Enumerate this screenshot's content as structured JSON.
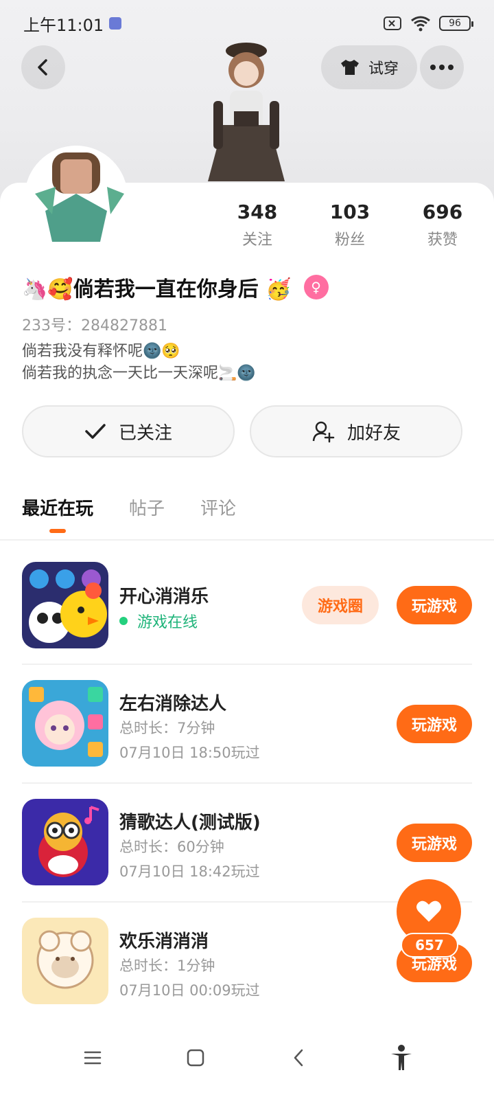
{
  "status_bar": {
    "time": "上午11:01",
    "battery": "96"
  },
  "header": {
    "try_on_label": "试穿"
  },
  "profile": {
    "stats": [
      {
        "value": "348",
        "label": "关注"
      },
      {
        "value": "103",
        "label": "粉丝"
      },
      {
        "value": "696",
        "label": "获赞"
      }
    ],
    "name": "🦄🥰倘若我一直在你身后 🥳",
    "id_label": "233号：284827881",
    "bio_lines": [
      "倘若我没有释怀呢🌚🥺",
      "倘若我的执念一天比一天深呢🚬🌚"
    ]
  },
  "actions": {
    "follow_label": "已关注",
    "add_friend_label": "加好友"
  },
  "tabs": [
    {
      "label": "最近在玩",
      "active": true
    },
    {
      "label": "帖子",
      "active": false
    },
    {
      "label": "评论",
      "active": false
    }
  ],
  "games": [
    {
      "title": "开心消消乐",
      "online": "游戏在线",
      "circle": "游戏圈",
      "play": "玩游戏"
    },
    {
      "title": "左右消除达人",
      "duration": "总时长：7分钟",
      "last_played": "07月10日 18:50玩过",
      "play": "玩游戏"
    },
    {
      "title": "猜歌达人(测试版)",
      "duration": "总时长：60分钟",
      "last_played": "07月10日 18:42玩过",
      "play": "玩游戏"
    },
    {
      "title": "欢乐消消消",
      "duration": "总时长：1分钟",
      "last_played": "07月10日 00:09玩过",
      "play": "玩游戏"
    }
  ],
  "like": {
    "count": "657"
  }
}
